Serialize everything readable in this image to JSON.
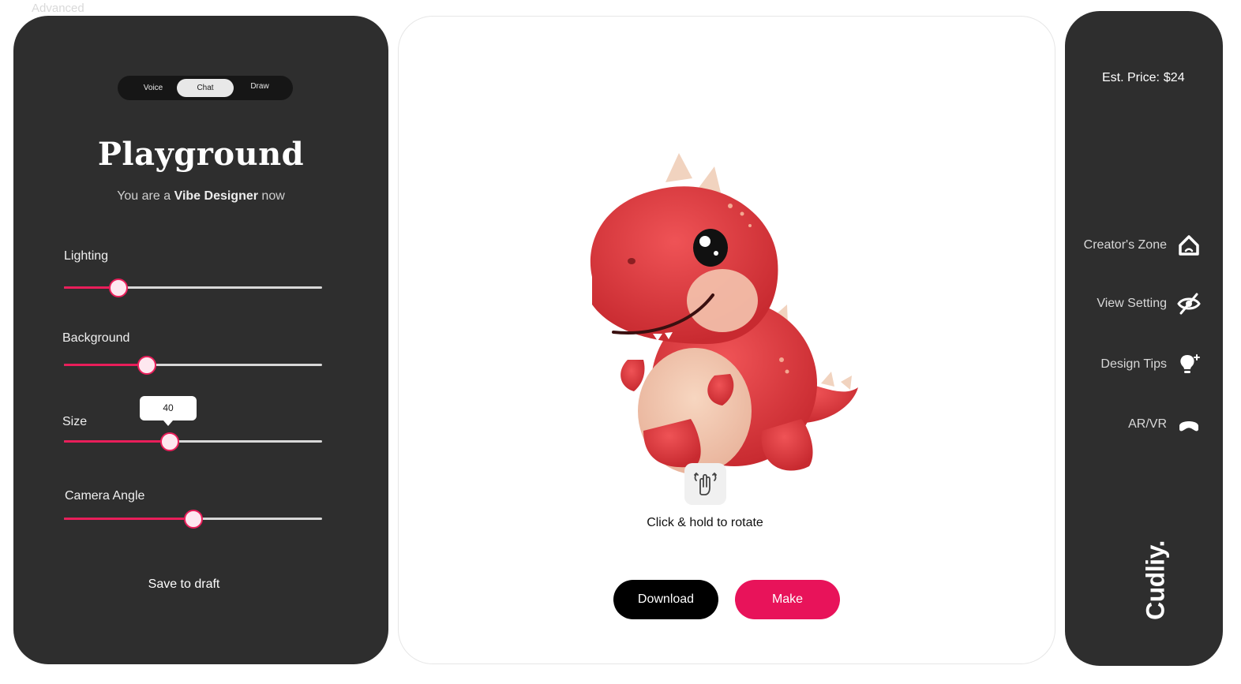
{
  "top_label": "Advanced",
  "mode_toggle": {
    "options": [
      "Voice",
      "Chat",
      "Draw"
    ],
    "selected": "Chat"
  },
  "playground": {
    "title": "Playground",
    "subtitle_prefix": "You are a ",
    "subtitle_bold": "Vibe Designer",
    "subtitle_suffix": " now"
  },
  "sliders": [
    {
      "label": "Lighting",
      "value_fraction": 0.21
    },
    {
      "label": "Background",
      "value_fraction": 0.32
    },
    {
      "label": "Size",
      "value_fraction": 0.41,
      "tooltip": "40"
    },
    {
      "label": "Camera Angle",
      "value_fraction": 0.5
    }
  ],
  "save_draft_label": "Save to draft",
  "preview": {
    "rotate_hint": "Click & hold to rotate",
    "download_label": "Download",
    "make_label": "Make"
  },
  "right_panel": {
    "price_label": "Est. Price:",
    "price_value": "$24",
    "menu": [
      {
        "label": "Creator's Zone",
        "icon": "home-icon"
      },
      {
        "label": "View Setting",
        "icon": "eye-off-icon"
      },
      {
        "label": "Design Tips",
        "icon": "lightbulb-icon"
      },
      {
        "label": "AR/VR",
        "icon": "vr-headset-icon"
      }
    ],
    "brand": "Cudliy."
  },
  "colors": {
    "accent": "#e8135a",
    "panel": "#2e2e2e",
    "dino_red": "#e0393e"
  }
}
